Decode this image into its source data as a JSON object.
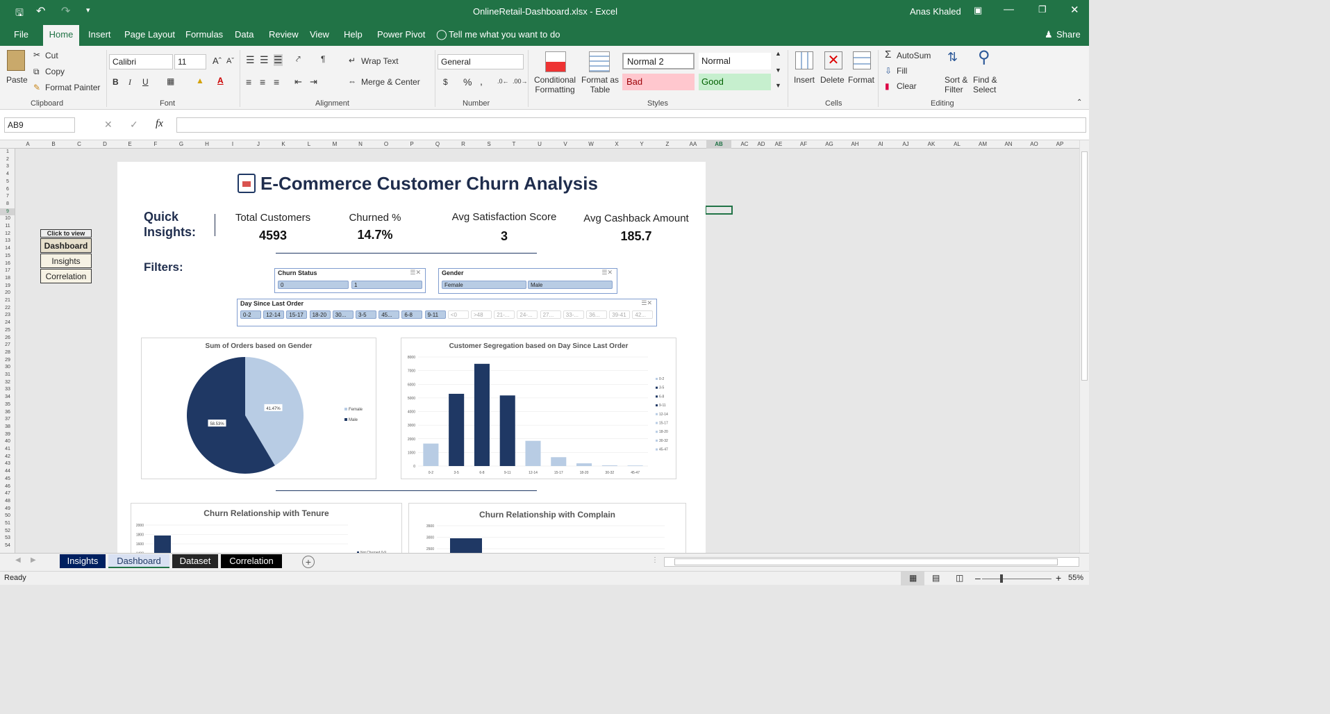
{
  "window": {
    "title": "OnlineRetail-Dashboard.xlsx  -  Excel",
    "user": "Anas Khaled"
  },
  "ribbon_tabs": [
    "File",
    "Home",
    "Insert",
    "Page Layout",
    "Formulas",
    "Data",
    "Review",
    "View",
    "Help",
    "Power Pivot"
  ],
  "tell_me": "Tell me what you want to do",
  "share": "Share",
  "clipboard": {
    "paste": "Paste",
    "cut": "Cut",
    "copy": "Copy",
    "format_painter": "Format Painter",
    "label": "Clipboard"
  },
  "font": {
    "name": "Calibri",
    "size": "11",
    "label": "Font",
    "bold": "B",
    "italic": "I",
    "underline": "U"
  },
  "alignment": {
    "wrap": "Wrap Text",
    "merge": "Merge & Center",
    "label": "Alignment"
  },
  "number": {
    "format": "General",
    "label": "Number",
    "currency": "$",
    "percent": "%",
    "comma": ","
  },
  "styles": {
    "conditional": [
      "Conditional",
      "Formatting"
    ],
    "format_table": [
      "Format as",
      "Table"
    ],
    "normal2": "Normal 2",
    "normal": "Normal",
    "bad": "Bad",
    "good": "Good",
    "label": "Styles"
  },
  "cells": {
    "insert": "Insert",
    "delete": "Delete",
    "format": "Format",
    "label": "Cells"
  },
  "editing": {
    "autosum": "AutoSum",
    "fill": "Fill",
    "clear": "Clear",
    "sort": [
      "Sort &",
      "Filter"
    ],
    "find": [
      "Find &",
      "Select"
    ],
    "label": "Editing"
  },
  "formula_bar": {
    "name_box": "AB9",
    "fx": "fx",
    "value": ""
  },
  "columns": [
    "A",
    "B",
    "C",
    "D",
    "E",
    "F",
    "G",
    "H",
    "I",
    "J",
    "K",
    "L",
    "M",
    "N",
    "O",
    "P",
    "Q",
    "R",
    "S",
    "T",
    "U",
    "V",
    "W",
    "X",
    "Y",
    "Z",
    "AA",
    "AB",
    "AC",
    "AD",
    "AE",
    "AF",
    "AG",
    "AH",
    "AI",
    "AJ",
    "AK",
    "AL",
    "AM",
    "AN",
    "AO",
    "AP"
  ],
  "nav_buttons": {
    "header": "Click to view",
    "items": [
      "Dashboard",
      "Insights",
      "Correlation"
    ]
  },
  "dashboard": {
    "title": "E-Commerce Customer Churn Analysis",
    "quick_label": [
      "Quick",
      "Insights:"
    ],
    "kpis": [
      {
        "label": "Total Customers",
        "value": "4593"
      },
      {
        "label": "Churned %",
        "value": "14.7%"
      },
      {
        "label": "Avg Satisfaction Score",
        "value": "3"
      },
      {
        "label": "Avg Cashback Amount",
        "value": "185.7"
      }
    ],
    "filters_label": "Filters:",
    "slicers": {
      "churn": {
        "title": "Churn Status",
        "items": [
          "0",
          "1"
        ]
      },
      "gender": {
        "title": "Gender",
        "items": [
          "Female",
          "Male"
        ]
      },
      "days": {
        "title": "Day Since Last Order",
        "active": [
          "0-2",
          "12-14",
          "15-17",
          "18-20",
          "30...",
          "3-5",
          "45...",
          "6-8",
          "9-11"
        ],
        "inactive": [
          "<0",
          ">48",
          "21-...",
          "24-...",
          "27...",
          "33-...",
          "36...",
          "39-41",
          "42..."
        ]
      }
    }
  },
  "chart_data": [
    {
      "type": "pie",
      "title": "Sum of Orders based on Gender",
      "categories": [
        "Female",
        "Male"
      ],
      "values": [
        41.47,
        58.53
      ],
      "labels": [
        "41.47%",
        "58.53%"
      ],
      "colors": [
        "#b8cce4",
        "#1f3864"
      ],
      "legend": "right"
    },
    {
      "type": "bar",
      "title": "Customer Segregation based on Day Since Last Order",
      "categories": [
        "0-2",
        "3-5",
        "6-8",
        "9-11",
        "12-14",
        "15-17",
        "18-20",
        "30-32",
        "45-47"
      ],
      "values": [
        1650,
        5300,
        7500,
        5180,
        1850,
        650,
        200,
        50,
        40
      ],
      "colors": [
        "#b8cce4",
        "#1f3864",
        "#1f3864",
        "#1f3864",
        "#b8cce4",
        "#b8cce4",
        "#b8cce4",
        "#b8cce4",
        "#b8cce4"
      ],
      "ylim": [
        0,
        8000
      ],
      "yticks": [
        "0",
        "1000",
        "2000",
        "3000",
        "4000",
        "5000",
        "6000",
        "7000",
        "8000"
      ],
      "legend": "right"
    },
    {
      "type": "bar",
      "title": "Churn Relationship with Tenure",
      "yticks": [
        "2000",
        "1800",
        "1600",
        "1400"
      ],
      "legend_item": "Not Churned 0-9"
    },
    {
      "type": "bar",
      "title": "Churn Relationship with Complain",
      "yticks": [
        "3500",
        "3000",
        "2500"
      ]
    }
  ],
  "sheet_tabs": [
    {
      "label": "Insights",
      "bg": "#002060",
      "color": "#ffffff"
    },
    {
      "label": "Dashboard",
      "bg": "#d9e1f2",
      "color": "#1f3864"
    },
    {
      "label": "Dataset",
      "bg": "#262626",
      "color": "#ffffff"
    },
    {
      "label": "Correlation",
      "bg": "#000000",
      "color": "#ffffff"
    }
  ],
  "status": {
    "text": "Ready",
    "zoom": "55%"
  }
}
